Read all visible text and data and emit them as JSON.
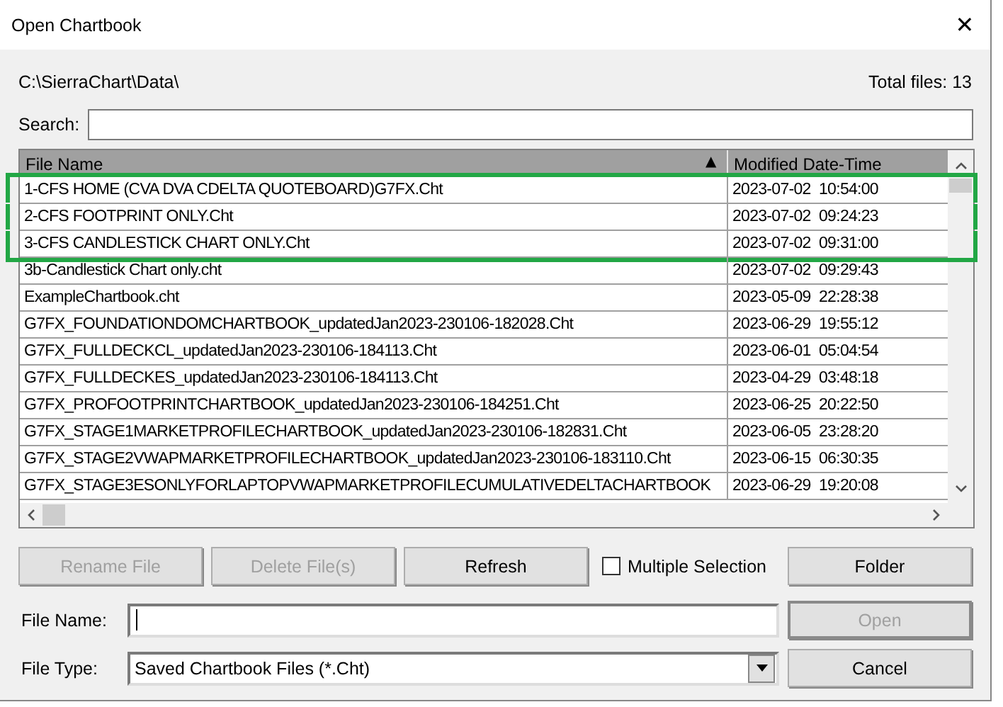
{
  "window": {
    "title": "Open Chartbook",
    "close": "✕"
  },
  "path": "C:\\SierraChart\\Data\\",
  "total_files": "Total files: 13",
  "search": {
    "label": "Search:"
  },
  "table": {
    "columns": [
      {
        "label": "File Name",
        "sort": "▲"
      },
      {
        "label": "Modified Date-Time"
      }
    ],
    "rows": [
      {
        "name": "1-CFS HOME (CVA DVA CDELTA QUOTEBOARD)G7FX.Cht",
        "date": "2023-07-02",
        "time": "10:54:00",
        "outlined": true
      },
      {
        "name": "2-CFS FOOTPRINT ONLY.Cht",
        "date": "2023-07-02",
        "time": "09:24:23",
        "outlined": true
      },
      {
        "name": "3-CFS CANDLESTICK CHART ONLY.Cht",
        "date": "2023-07-02",
        "time": "09:31:00",
        "outlined": true
      },
      {
        "name": "3b-Candlestick Chart only.cht",
        "date": "2023-07-02",
        "time": "09:29:43",
        "outlined": false
      },
      {
        "name": "ExampleChartbook.cht",
        "date": "2023-05-09",
        "time": "22:28:38",
        "outlined": false
      },
      {
        "name": "G7FX_FOUNDATIONDOMCHARTBOOK_updatedJan2023-230106-182028.Cht",
        "date": "2023-06-29",
        "time": "19:55:12",
        "outlined": false
      },
      {
        "name": "G7FX_FULLDECKCL_updatedJan2023-230106-184113.Cht",
        "date": "2023-06-01",
        "time": "05:04:54",
        "outlined": false
      },
      {
        "name": "G7FX_FULLDECKES_updatedJan2023-230106-184113.Cht",
        "date": "2023-04-29",
        "time": "03:48:18",
        "outlined": false
      },
      {
        "name": "G7FX_PROFOOTPRINTCHARTBOOK_updatedJan2023-230106-184251.Cht",
        "date": "2023-06-25",
        "time": "20:22:50",
        "outlined": false
      },
      {
        "name": "G7FX_STAGE1MARKETPROFILECHARTBOOK_updatedJan2023-230106-182831.Cht",
        "date": "2023-06-05",
        "time": "23:28:20",
        "outlined": false
      },
      {
        "name": "G7FX_STAGE2VWAPMARKETPROFILECHARTBOOK_updatedJan2023-230106-183110.Cht",
        "date": "2023-06-15",
        "time": "06:30:35",
        "outlined": false
      },
      {
        "name": "G7FX_STAGE3ESONLYFORLAPTOPVWAPMARKETPROFILECUMULATIVEDELTACHARTBOOK",
        "date": "2023-06-29",
        "time": "19:20:08",
        "outlined": false
      }
    ]
  },
  "buttons": [
    {
      "label": "Rename File",
      "disabled": true
    },
    {
      "label": "Delete File(s)",
      "disabled": true
    },
    {
      "label": "Refresh",
      "disabled": false
    }
  ],
  "multiple_selection": {
    "label": "Multiple Selection",
    "checked": false
  },
  "folder_button": {
    "label": "Folder",
    "disabled": false
  },
  "file_name": {
    "label": "File Name:"
  },
  "open_button": {
    "label": "Open",
    "disabled": true
  },
  "file_type": {
    "label": "File Type:",
    "value": "Saved Chartbook Files (*.Cht)"
  },
  "cancel_button": {
    "label": "Cancel",
    "disabled": false
  }
}
